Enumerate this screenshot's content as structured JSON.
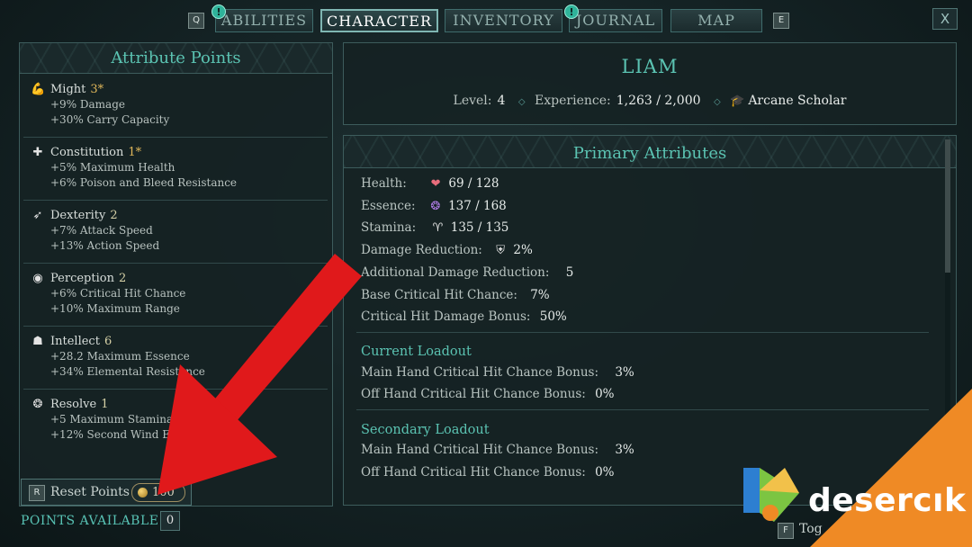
{
  "tabs": {
    "prev_key": "Q",
    "next_key": "E",
    "close_label": "X",
    "items": [
      {
        "label": "ABILITIES",
        "notif": "!"
      },
      {
        "label": "CHARACTER"
      },
      {
        "label": "INVENTORY"
      },
      {
        "label": "JOURNAL",
        "notif": "!"
      },
      {
        "label": "MAP"
      }
    ]
  },
  "attributes_panel": {
    "title": "Attribute Points",
    "items": [
      {
        "icon": "might-icon",
        "name": "Might",
        "value": "3*",
        "lines": [
          "+9% Damage",
          "+30% Carry Capacity"
        ]
      },
      {
        "icon": "constitution-icon",
        "name": "Constitution",
        "value": "1*",
        "lines": [
          "+5% Maximum Health",
          "+6% Poison and Bleed Resistance"
        ]
      },
      {
        "icon": "dexterity-icon",
        "name": "Dexterity",
        "value": "2",
        "lines": [
          "+7% Attack Speed",
          "+13% Action Speed"
        ]
      },
      {
        "icon": "perception-icon",
        "name": "Perception",
        "value": "2",
        "lines": [
          "+6% Critical Hit Chance",
          "+10% Maximum Range"
        ]
      },
      {
        "icon": "intellect-icon",
        "name": "Intellect",
        "value": "6",
        "lines": [
          "+28.2 Maximum Essence",
          "+34% Elemental Resistance"
        ]
      },
      {
        "icon": "resolve-icon",
        "name": "Resolve",
        "value": "1",
        "lines": [
          "+5 Maximum Stamina",
          "+12% Second Wind Efficien"
        ]
      }
    ],
    "reset": {
      "key": "R",
      "label": "Reset Points",
      "cost": "100"
    },
    "points_available_label": "POINTS AVAILABLE",
    "points_available_value": "0"
  },
  "character": {
    "name": "LIAM",
    "level_label": "Level:",
    "level": "4",
    "experience_label": "Experience:",
    "experience": "1,263 / 2,000",
    "class_icon": "graduation-cap-icon",
    "class_name": "Arcane Scholar"
  },
  "primary": {
    "title": "Primary Attributes",
    "stats": [
      {
        "label": "Health:",
        "icon": "heart-icon",
        "value": "69 / 128"
      },
      {
        "label": "Essence:",
        "icon": "essence-swirl-icon",
        "value": "137 / 168"
      },
      {
        "label": "Stamina:",
        "icon": "lungs-icon",
        "value": "135 / 135"
      },
      {
        "label": "Damage Reduction:",
        "icon": "shield-icon",
        "value": "2%"
      },
      {
        "label": "Additional Damage Reduction:",
        "value": "5"
      },
      {
        "label": "Base Critical Hit Chance:",
        "value": "7%"
      },
      {
        "label": "Critical Hit Damage Bonus:",
        "value": "50%"
      }
    ],
    "current_loadout": {
      "title": "Current Loadout",
      "rows": [
        {
          "label": "Main Hand Critical Hit Chance Bonus:",
          "value": "3%"
        },
        {
          "label": "Off Hand Critical Hit Chance Bonus:",
          "value": "0%"
        }
      ]
    },
    "secondary_loadout": {
      "title": "Secondary Loadout",
      "rows": [
        {
          "label": "Main Hand Critical Hit Chance Bonus:",
          "value": "3%"
        },
        {
          "label": "Off Hand Critical Hit Chance Bonus:",
          "value": "0%"
        }
      ]
    }
  },
  "footer": {
    "toggle_key": "F",
    "toggle_label": "Tog"
  },
  "watermark": {
    "brand": "desercık"
  },
  "colors": {
    "accent": "#5bc3b2",
    "arrow": "#e0191b",
    "watermark_orange": "#ef8a25"
  }
}
